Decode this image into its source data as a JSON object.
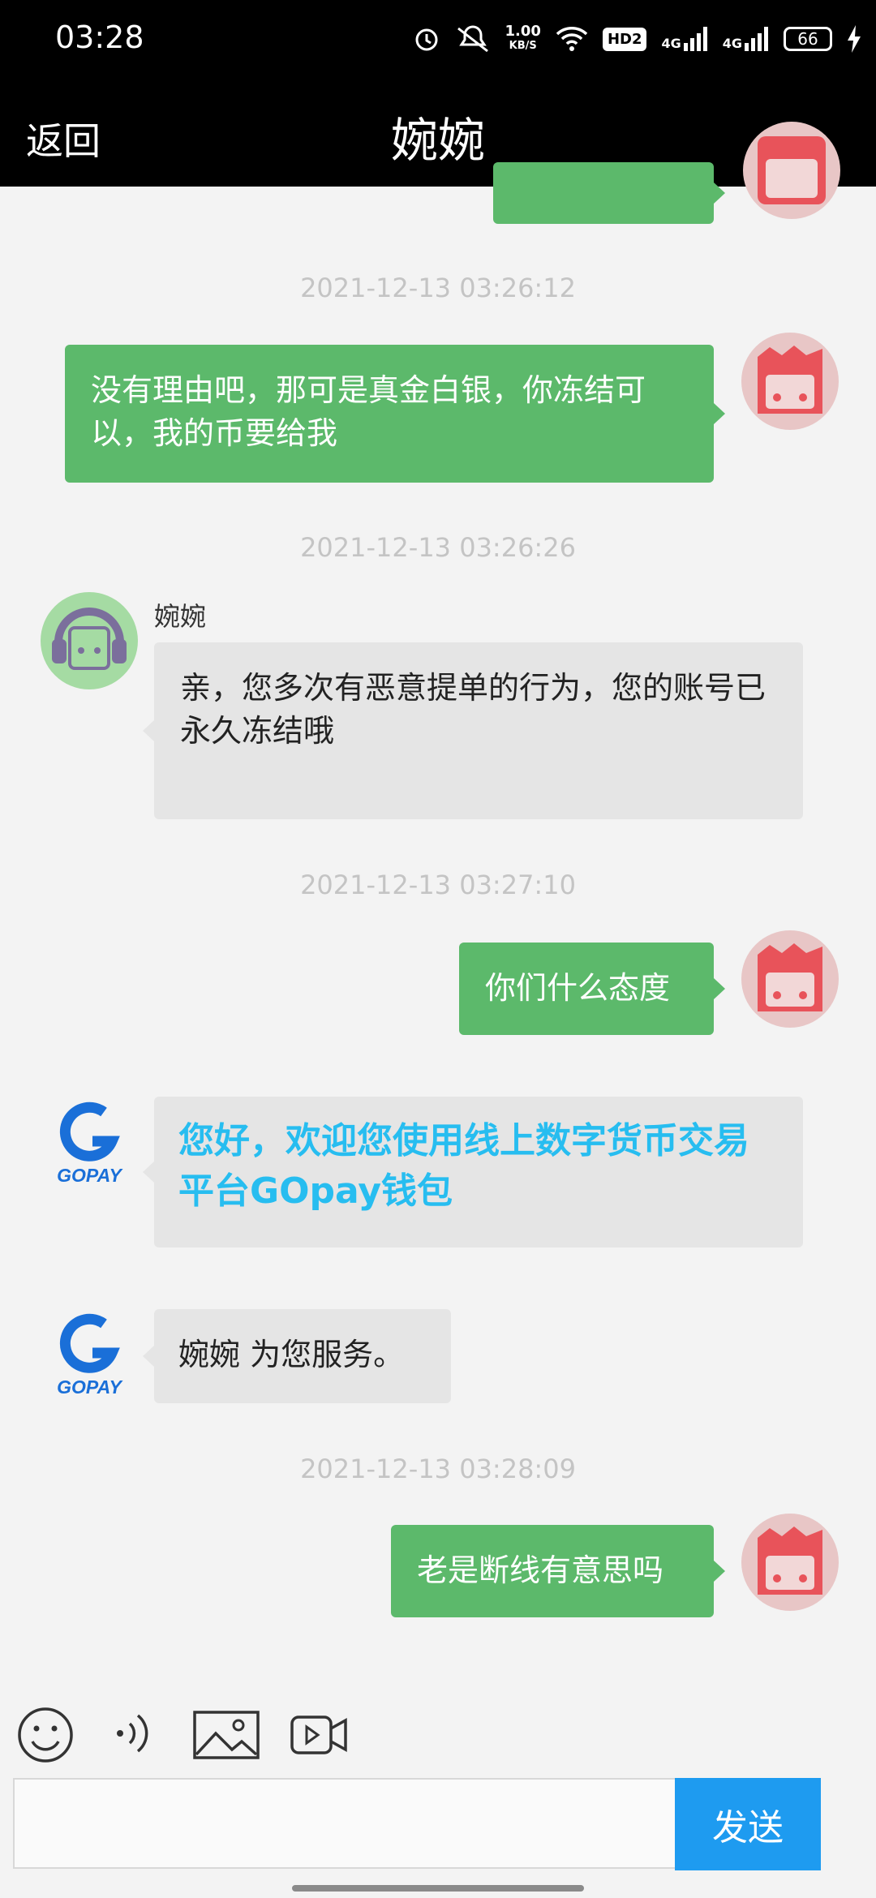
{
  "status_bar": {
    "time": "03:28",
    "net_speed_value": "1.00",
    "net_speed_unit": "KB/S",
    "hd_label": "HD2",
    "sim1_label": "4G",
    "sim2_label": "4G",
    "battery_percent": "66"
  },
  "header": {
    "back_label": "返回",
    "title": "婉婉"
  },
  "chat": {
    "messages": [
      {
        "timestamp": "2021-12-13 03:26:12",
        "from": "user",
        "text": "没有理由吧，那可是真金白银，你冻结可以，我的币要给我"
      },
      {
        "timestamp": "2021-12-13 03:26:26",
        "from": "agent",
        "sender": "婉婉",
        "text": "亲，您多次有恶意提单的行为，您的账号已永久冻结哦"
      },
      {
        "timestamp": "2021-12-13 03:27:10",
        "from": "user",
        "text": "你们什么态度"
      },
      {
        "from": "bot",
        "text": "您好，欢迎您使用线上数字货币交易平台GOpay钱包"
      },
      {
        "from": "bot",
        "text": "婉婉 为您服务。"
      },
      {
        "timestamp": "2021-12-13 03:28:09",
        "from": "user",
        "text": "老是断线有意思吗"
      }
    ]
  },
  "gopay_logo_text": "GOPAY",
  "input_bar": {
    "placeholder": "",
    "send_label": "发送"
  },
  "colors": {
    "user_bubble": "#5cb96b",
    "agent_bubble": "#e5e5e5",
    "bot_highlight_text": "#27bdf0",
    "send_button": "#1e9bf0",
    "header_bg": "#000000"
  }
}
